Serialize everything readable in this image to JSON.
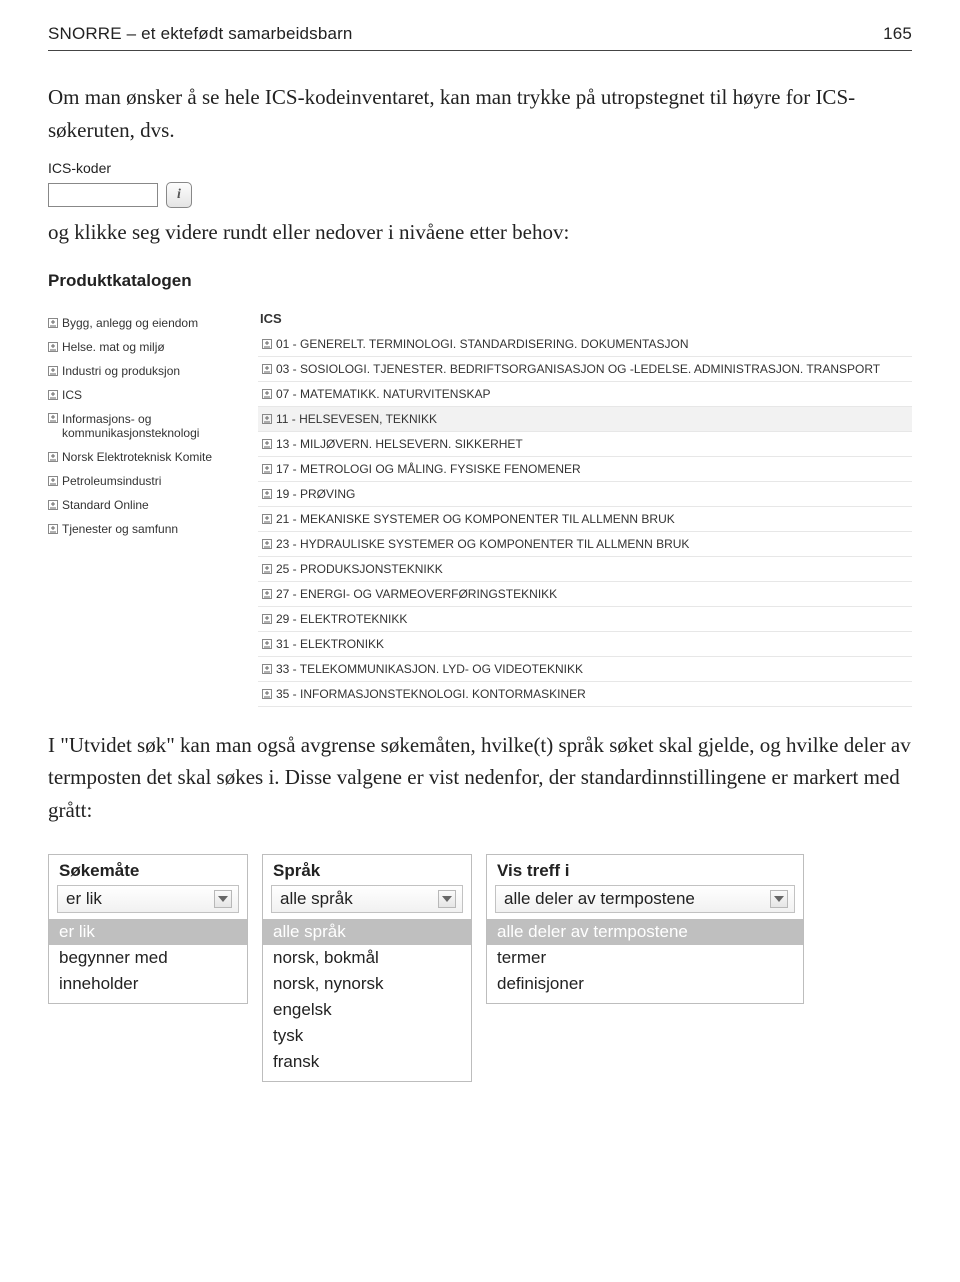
{
  "header": {
    "title": "SNORRE – et ektefødt samarbeidsbarn",
    "page": "165"
  },
  "p1": "Om man ønsker å se hele ICS-kodeinventaret, kan man trykke på utropstegnet til høyre for ICS-søkeruten, dvs.",
  "p2": "og klikke seg videre rundt eller nedover i nivåene etter behov:",
  "p3": "I \"Utvidet søk\" kan man også avgrense søkemåten, hvilke(t) språk søket skal gjelde, og hvilke deler av termposten det skal søkes i. Disse valgene er vist nedenfor, der standardinnstillingene er markert med grått:",
  "ics_koder": {
    "label": "ICS-koder",
    "info_char": "i"
  },
  "pk": {
    "title": "Produktkatalogen",
    "sidebar_items": [
      "Bygg, anlegg og eiendom",
      "Helse. mat og miljø",
      "Industri og produksjon",
      "ICS",
      "Informasjons- og kommunikasjonsteknologi",
      "Norsk Elektroteknisk Komite",
      "Petroleumsindustri",
      "Standard Online",
      "Tjenester og samfunn"
    ],
    "main_head": "ICS",
    "rows": [
      {
        "label": "01 - GENERELT. TERMINOLOGI. STANDARDISERING. DOKUMENTASJON",
        "hl": false
      },
      {
        "label": "03 - SOSIOLOGI. TJENESTER. BEDRIFTSORGANISASJON OG -LEDELSE. ADMINISTRASJON. TRANSPORT",
        "hl": false
      },
      {
        "label": "07 - MATEMATIKK. NATURVITENSKAP",
        "hl": false
      },
      {
        "label": "11 - HELSEVESEN, TEKNIKK",
        "hl": true
      },
      {
        "label": "13 - MILJØVERN. HELSEVERN. SIKKERHET",
        "hl": false
      },
      {
        "label": "17 - METROLOGI OG MÅLING. FYSISKE FENOMENER",
        "hl": false
      },
      {
        "label": "19 - PRØVING",
        "hl": false
      },
      {
        "label": "21 - MEKANISKE SYSTEMER OG KOMPONENTER TIL ALLMENN BRUK",
        "hl": false
      },
      {
        "label": "23 - HYDRAULISKE SYSTEMER OG KOMPONENTER TIL ALLMENN BRUK",
        "hl": false
      },
      {
        "label": "25 - PRODUKSJONSTEKNIKK",
        "hl": false
      },
      {
        "label": "27 - ENERGI- OG VARMEOVERFØRINGSTEKNIKK",
        "hl": false
      },
      {
        "label": "29 - ELEKTROTEKNIKK",
        "hl": false
      },
      {
        "label": "31 - ELEKTRONIKK",
        "hl": false
      },
      {
        "label": "33 - TELEKOMMUNIKASJON. LYD- OG VIDEOTEKNIKK",
        "hl": false
      },
      {
        "label": "35 - INFORMASJONSTEKNOLOGI. KONTORMASKINER",
        "hl": false
      }
    ]
  },
  "controls": {
    "sokemate": {
      "title": "Søkemåte",
      "selected": "er lik",
      "options": [
        "er lik",
        "begynner med",
        "inneholder"
      ]
    },
    "sprak": {
      "title": "Språk",
      "selected": "alle språk",
      "options": [
        "alle språk",
        "norsk, bokmål",
        "norsk, nynorsk",
        "engelsk",
        "tysk",
        "fransk"
      ]
    },
    "vis": {
      "title": "Vis treff i",
      "selected": "alle deler av termpostene",
      "options": [
        "alle deler av termpostene",
        "termer",
        "definisjoner"
      ]
    }
  }
}
